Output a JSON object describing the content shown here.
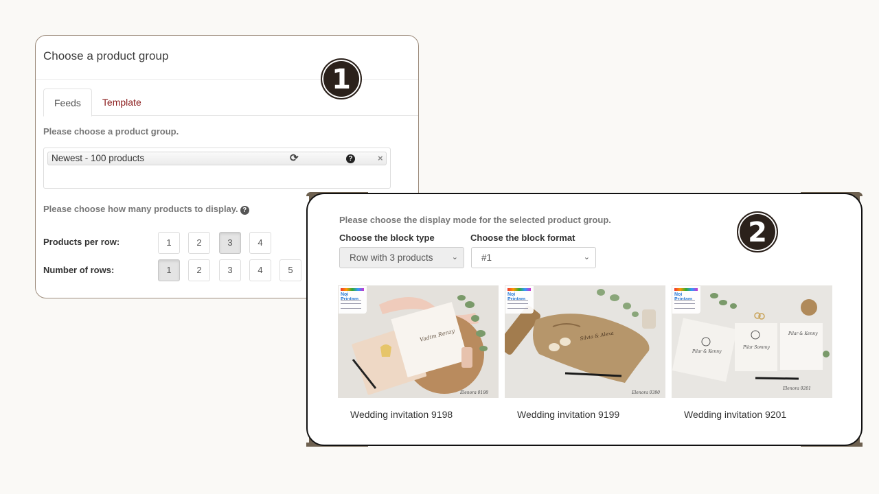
{
  "card1": {
    "title": "Choose a product group",
    "badge": "1",
    "tabs": [
      {
        "label": "Feeds",
        "active": true
      },
      {
        "label": "Template",
        "active": false
      }
    ],
    "product_group_prompt": "Please choose a product group.",
    "selected_group": {
      "label": "Newest - 100 products",
      "icons": [
        "refresh-icon",
        "help-icon",
        "close-icon"
      ],
      "refresh_glyph": "⟳",
      "help_glyph": "?",
      "close_glyph": "×"
    },
    "count_prompt": "Please choose how many products to display.",
    "count_help_glyph": "?",
    "products_per_row": {
      "label": "Products per row:",
      "options": [
        "1",
        "2",
        "3",
        "4"
      ],
      "selected": "3"
    },
    "number_of_rows": {
      "label": "Number of rows:",
      "options": [
        "1",
        "2",
        "3",
        "4",
        "5"
      ],
      "selected": "1"
    }
  },
  "card2": {
    "badge": "2",
    "prompt": "Please choose the display mode for the selected product group.",
    "block_type": {
      "label": "Choose the block type",
      "value": "Row with 3 products",
      "disabled": true
    },
    "block_format": {
      "label": "Choose the block format",
      "value": "#1"
    },
    "chevron_glyph": "⌄",
    "products": [
      {
        "title": "Wedding invitation 9198",
        "image": "peach-wedding-invitation-photo"
      },
      {
        "title": "Wedding invitation 9199",
        "image": "kraft-scroll-wedding-invitation-photo"
      },
      {
        "title": "Wedding invitation 9201",
        "image": "white-geometric-wedding-invitation-photo"
      }
    ]
  },
  "colors": {
    "background": "#faf9f6",
    "card1_border": "#9b8a7a",
    "card2_border": "#111111",
    "accent": "#6e6150",
    "badge": "#2b211b",
    "tab_inactive": "#8b1c1c"
  }
}
